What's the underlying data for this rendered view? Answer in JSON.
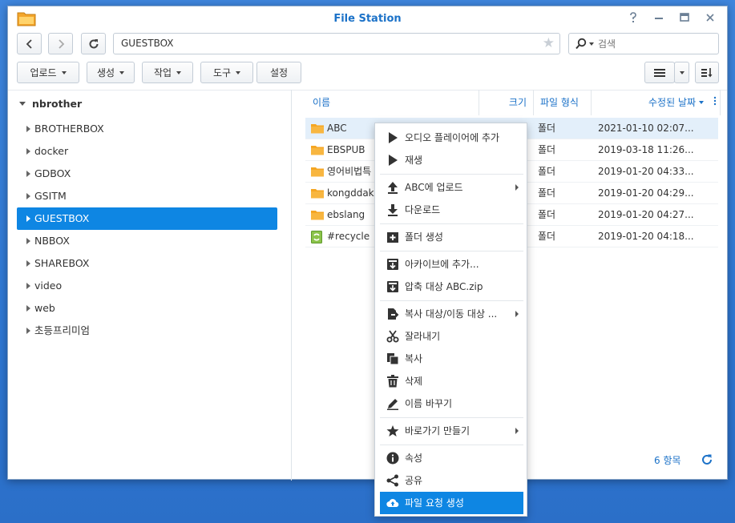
{
  "window": {
    "title": "File Station"
  },
  "nav": {
    "path": "GUESTBOX",
    "search_placeholder": "검색"
  },
  "toolbar": {
    "upload": "업로드",
    "create": "생성",
    "action": "작업",
    "tools": "도구",
    "settings": "설정"
  },
  "tree": {
    "root": "nbrother",
    "items": [
      {
        "label": "BROTHERBOX"
      },
      {
        "label": "docker"
      },
      {
        "label": "GDBOX"
      },
      {
        "label": "GSITM"
      },
      {
        "label": "GUESTBOX",
        "selected": true
      },
      {
        "label": "NBBOX"
      },
      {
        "label": "SHAREBOX"
      },
      {
        "label": "video"
      },
      {
        "label": "web"
      },
      {
        "label": "초등프리미엄"
      }
    ]
  },
  "columns": {
    "name": "이름",
    "size": "크기",
    "type": "파일 형식",
    "modified": "수정된 날짜"
  },
  "files": [
    {
      "name": "ABC",
      "type": "폴더",
      "modified": "2021-01-10 02:07...",
      "icon": "folder-icon",
      "selected": true
    },
    {
      "name": "EBSPUB",
      "type": "폴더",
      "modified": "2019-03-18 11:26...",
      "icon": "folder-icon"
    },
    {
      "name": "영어비법특",
      "type": "폴더",
      "modified": "2019-01-20 04:33...",
      "icon": "folder-icon"
    },
    {
      "name": "kongddak",
      "type": "폴더",
      "modified": "2019-01-20 04:29...",
      "icon": "folder-icon"
    },
    {
      "name": "ebslang",
      "type": "폴더",
      "modified": "2019-01-20 04:27...",
      "icon": "folder-icon"
    },
    {
      "name": "#recycle",
      "type": "폴더",
      "modified": "2019-01-20 04:18...",
      "icon": "recycle-folder-icon"
    }
  ],
  "status": {
    "count": "6 항목"
  },
  "context_menu": {
    "items": [
      {
        "label": "오디오 플레이어에 추가",
        "icon": "play-icon"
      },
      {
        "label": "재생",
        "icon": "play-icon"
      },
      {
        "label": "ABC에 업로드",
        "icon": "upload-icon",
        "submenu": true
      },
      {
        "label": "다운로드",
        "icon": "download-icon"
      },
      {
        "label": "폴더 생성",
        "icon": "new-folder-icon"
      },
      {
        "label": "아카이브에 추가...",
        "icon": "archive-icon"
      },
      {
        "label": "압축 대상 ABC.zip",
        "icon": "archive-icon"
      },
      {
        "label": "복사 대상/이동 대상 ...",
        "icon": "copy-move-icon",
        "submenu": true
      },
      {
        "label": "잘라내기",
        "icon": "scissors-icon"
      },
      {
        "label": "복사",
        "icon": "copy-icon"
      },
      {
        "label": "삭제",
        "icon": "trash-icon"
      },
      {
        "label": "이름 바꾸기",
        "icon": "pencil-icon"
      },
      {
        "label": "바로가기 만들기",
        "icon": "star-icon",
        "submenu": true
      },
      {
        "label": "속성",
        "icon": "info-icon"
      },
      {
        "label": "공유",
        "icon": "share-icon"
      },
      {
        "label": "파일 요청 생성",
        "icon": "cloud-upload-icon",
        "highlighted": true
      }
    ]
  },
  "colors": {
    "accent": "#1c72c8",
    "selection": "#0e86e3",
    "folder": "#f5a623",
    "desktop": "#2f78d4"
  }
}
